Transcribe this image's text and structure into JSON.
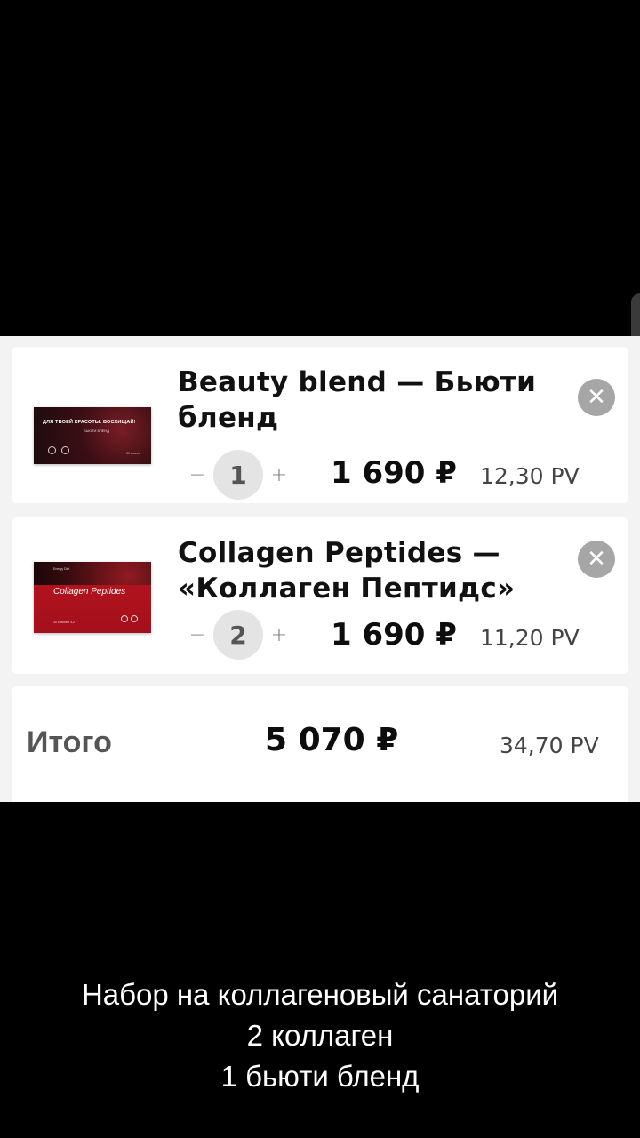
{
  "cart": {
    "items": [
      {
        "title": "Beauty blend — Бьюти бленд",
        "quantity": "1",
        "minus": "−",
        "plus": "+",
        "price": "1 690 ₽",
        "pv": "12,30 PV",
        "remove_icon": "close-icon",
        "thumb": {
          "headline": "ДЛЯ ТВОЕЙ КРАСОТЫ. ВОСХИЩАЙ!",
          "subline": "БЬЮТИ БЛЕНД",
          "small": "30 стиков"
        }
      },
      {
        "title": "Collagen Peptides — «Коллаген Пептидс»",
        "quantity": "2",
        "minus": "−",
        "plus": "+",
        "price": "1 690 ₽",
        "pv": "11,20 PV",
        "remove_icon": "close-icon",
        "thumb": {
          "brand": "Energy Diet",
          "title": "Collagen Peptides",
          "small": "30 стиков х 4,2 г"
        }
      }
    ],
    "total": {
      "label": "Итого",
      "price": "5 070 ₽",
      "pv": "34,70 PV"
    }
  },
  "caption": {
    "line1": "Набор на коллагеновый санаторий",
    "line2": "2 коллаген",
    "line3": "1 бьюти бленд"
  },
  "colors": {
    "background": "#000000",
    "panel": "#f3f3f3",
    "card": "#ffffff",
    "remove_button": "#a6a6a6",
    "quantity_bubble": "#e4e4e4"
  }
}
